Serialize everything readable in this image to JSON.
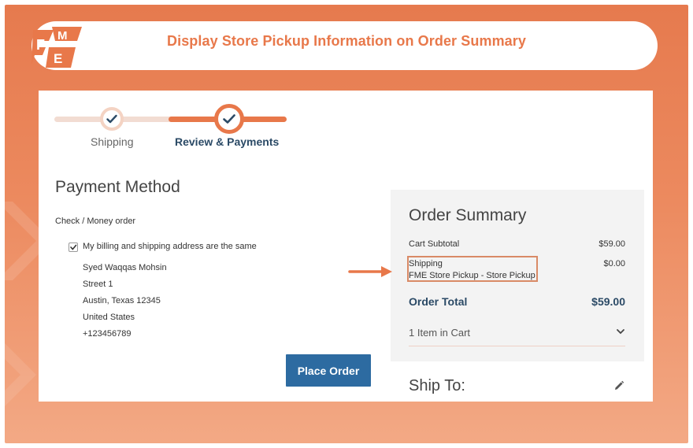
{
  "header": {
    "logo_text": "FME",
    "title": "Display Store Pickup Information on Order Summary"
  },
  "progress": {
    "steps": [
      {
        "label": "Shipping",
        "state": "complete"
      },
      {
        "label": "Review & Payments",
        "state": "active"
      }
    ]
  },
  "payment": {
    "title": "Payment Method",
    "method": "Check / Money order",
    "same_address_label": "My billing and shipping address are the same",
    "same_address_checked": true,
    "address": [
      "Syed Waqqas Mohsin",
      "Street 1",
      "Austin, Texas 12345",
      "United States",
      "+123456789"
    ],
    "place_order_label": "Place Order"
  },
  "summary": {
    "title": "Order Summary",
    "subtotal_label": "Cart Subtotal",
    "subtotal_value": "$59.00",
    "shipping_label": "Shipping",
    "shipping_method": "FME Store Pickup - Store Pickup",
    "shipping_value": "$0.00",
    "total_label": "Order Total",
    "total_value": "$59.00",
    "items_label": "1 Item in Cart"
  },
  "ship_to": {
    "title": "Ship To:"
  },
  "colors": {
    "brand_orange": "#e8784a",
    "primary_blue": "#2d6ba1",
    "heading_navy": "#2b4a66"
  },
  "icons": [
    "check-icon",
    "chevron-down-icon",
    "pencil-icon",
    "arrow-right-icon"
  ]
}
